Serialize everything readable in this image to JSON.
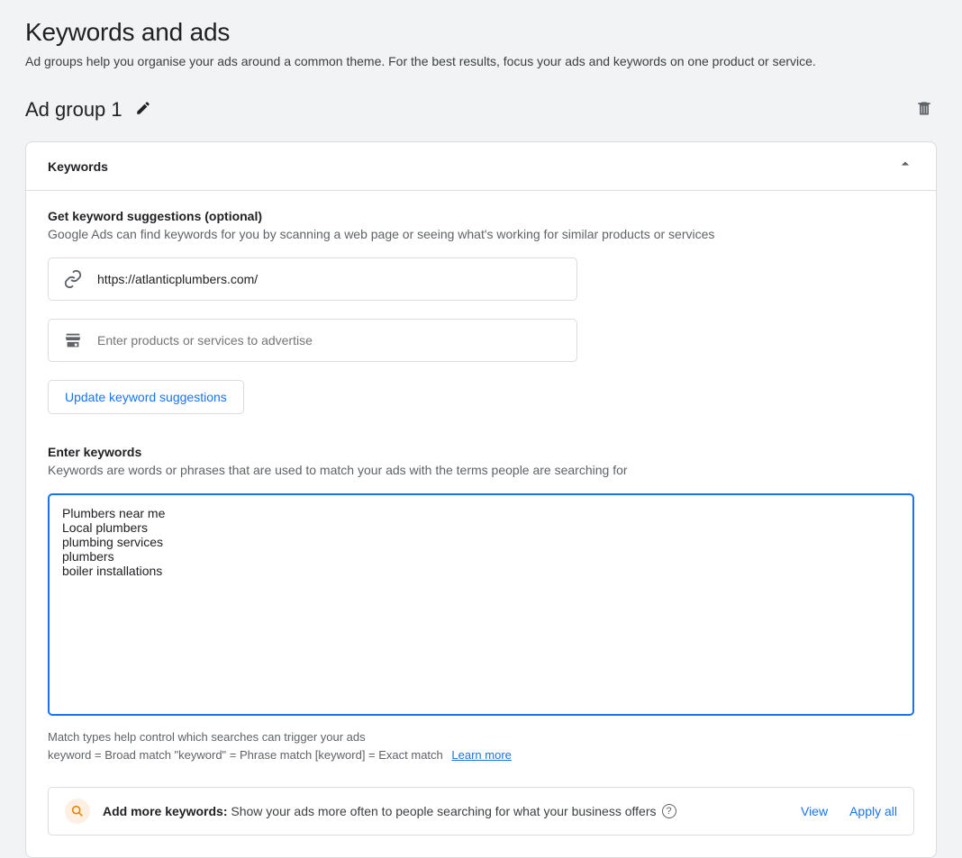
{
  "page": {
    "title": "Keywords and ads",
    "subtitle": "Ad groups help you organise your ads around a common theme. For the best results, focus your ads and keywords on one product or service."
  },
  "group": {
    "title": "Ad group 1"
  },
  "card": {
    "title": "Keywords",
    "suggestions": {
      "title": "Get keyword suggestions (optional)",
      "desc": "Google Ads can find keywords for you by scanning a web page or seeing what's working for similar products or services",
      "url_value": "https://atlanticplumbers.com/",
      "products_placeholder": "Enter products or services to advertise",
      "update_btn": "Update keyword suggestions"
    },
    "keywords": {
      "title": "Enter keywords",
      "desc": "Keywords are words or phrases that are used to match your ads with the terms people are searching for",
      "value": "Plumbers near me\nLocal plumbers\nplumbing services\nplumbers\nboiler installations",
      "hint1": "Match types help control which searches can trigger your ads",
      "hint2": "keyword = Broad match   \"keyword\" = Phrase match   [keyword] = Exact match",
      "learn_more": "Learn more"
    },
    "promo": {
      "bold": "Add more keywords:",
      "text": "Show your ads more often to people searching for what your business offers",
      "view": "View",
      "apply": "Apply all"
    }
  }
}
